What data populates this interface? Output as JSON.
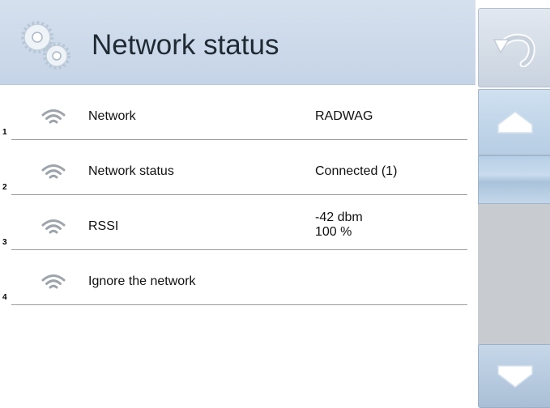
{
  "header": {
    "title": "Network status",
    "icon": "gears-icon"
  },
  "rows": [
    {
      "number": "1",
      "icon": "wifi-icon",
      "label": "Network",
      "value": "RADWAG"
    },
    {
      "number": "2",
      "icon": "wifi-icon",
      "label": "Network status",
      "value": "Connected (1)"
    },
    {
      "number": "3",
      "icon": "wifi-icon",
      "label": "RSSI",
      "value": "-42 dbm\n100 %"
    },
    {
      "number": "4",
      "icon": "wifi-icon",
      "label": "Ignore the network",
      "value": ""
    }
  ],
  "side_panel": {
    "back_icon": "undo-arrow-icon",
    "up_icon": "arrow-up-icon",
    "down_icon": "arrow-down-icon"
  },
  "colors": {
    "header_bg": "#c9d7e9",
    "button_blue": "#b9cfe5",
    "scroll_track": "#c8ccd0"
  }
}
